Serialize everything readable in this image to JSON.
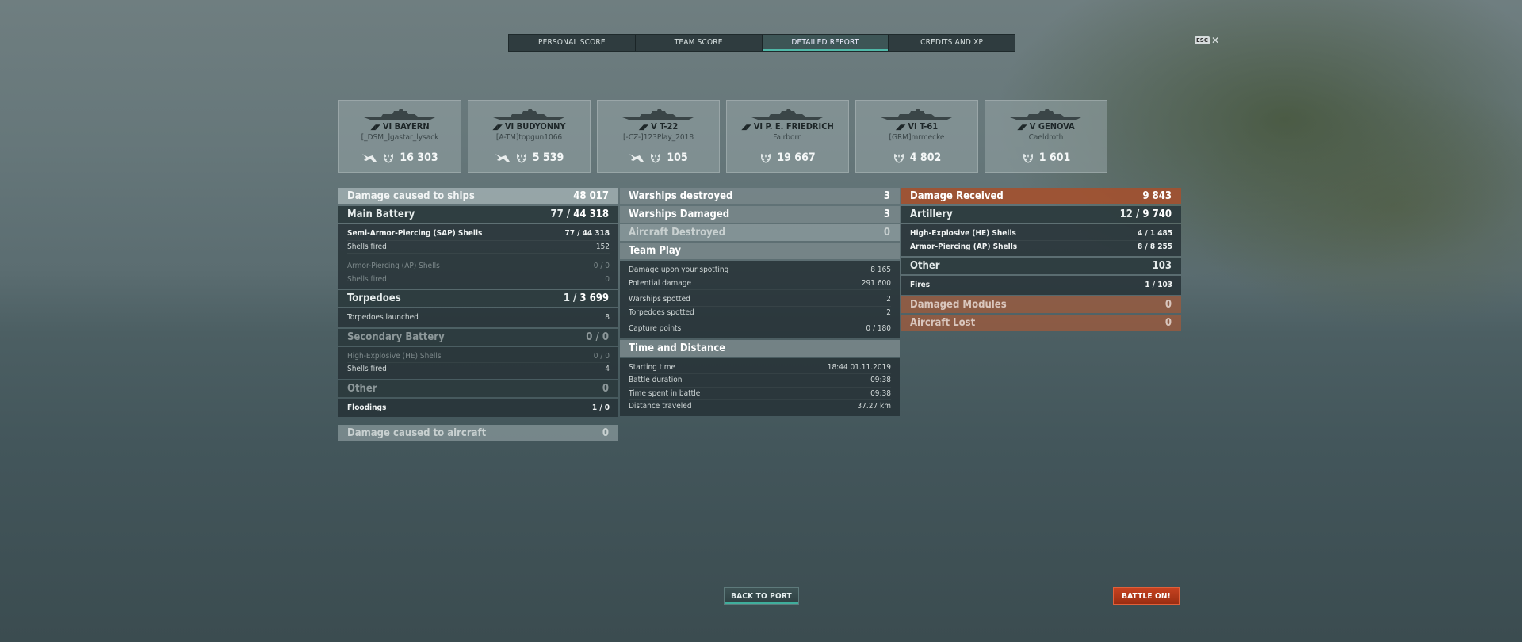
{
  "tabs": [
    {
      "label": "PERSONAL SCORE"
    },
    {
      "label": "TEAM SCORE"
    },
    {
      "label": "DETAILED REPORT"
    },
    {
      "label": "CREDITS AND XP"
    }
  ],
  "esc": {
    "key": "ESC",
    "close": "✕"
  },
  "ships": [
    {
      "name": "VI BAYERN",
      "player": "[_DSM_]gastar_lysack",
      "xp": "16 303",
      "has_plane": true
    },
    {
      "name": "VI BUDYONNY",
      "player": "[A-TM]topgun1066",
      "xp": "5 539",
      "has_plane": true
    },
    {
      "name": "V T-22",
      "player": "[-CZ-]123Play_2018",
      "xp": "105",
      "has_plane": true
    },
    {
      "name": "VI P. E. FRIEDRICH",
      "player": "Fairborn",
      "xp": "19 667",
      "has_plane": false
    },
    {
      "name": "VI T-61",
      "player": "[GRM]mrmecke",
      "xp": "4 802",
      "has_plane": false
    },
    {
      "name": "V GENOVA",
      "player": "Caeldroth",
      "xp": "1 601",
      "has_plane": false
    }
  ],
  "col1": {
    "damage_ships": {
      "label": "Damage caused to ships",
      "value": "48 017"
    },
    "main_battery": {
      "label": "Main Battery",
      "hits": "77",
      "value": "44 318"
    },
    "sap": {
      "label": "Semi-Armor-Piercing (SAP) Shells",
      "hits": "77",
      "value": "44 318"
    },
    "sap_fired": {
      "label": "Shells fired",
      "value": "152"
    },
    "ap": {
      "label": "Armor-Piercing (AP) Shells",
      "hits": "0",
      "value": "0"
    },
    "ap_fired": {
      "label": "Shells fired",
      "value": "0"
    },
    "torpedoes": {
      "label": "Torpedoes",
      "hits": "1",
      "value": "3 699"
    },
    "torp_launched": {
      "label": "Torpedoes launched",
      "value": "8"
    },
    "secondary": {
      "label": "Secondary Battery",
      "hits": "0",
      "value": "0"
    },
    "he": {
      "label": "High-Explosive (HE) Shells",
      "hits": "0",
      "value": "0"
    },
    "he_fired": {
      "label": "Shells fired",
      "value": "4"
    },
    "other": {
      "label": "Other",
      "value": "0"
    },
    "floodings": {
      "label": "Floodings",
      "hits": "1",
      "value": "0"
    },
    "damage_aircraft": {
      "label": "Damage caused to aircraft",
      "value": "0"
    }
  },
  "col2": {
    "destroyed": {
      "label": "Warships destroyed",
      "value": "3"
    },
    "damaged": {
      "label": "Warships Damaged",
      "value": "3"
    },
    "aircraft": {
      "label": "Aircraft Destroyed",
      "value": "0"
    },
    "team_play": {
      "label": "Team Play"
    },
    "spotting_dmg": {
      "label": "Damage upon your spotting",
      "value": "8 165"
    },
    "potential": {
      "label": "Potential damage",
      "value": "291 600"
    },
    "ws_spotted": {
      "label": "Warships spotted",
      "value": "2"
    },
    "tp_spotted": {
      "label": "Torpedoes spotted",
      "value": "2"
    },
    "capture": {
      "label": "Capture points",
      "value": "0 / 180"
    },
    "time": {
      "label": "Time and Distance"
    },
    "start": {
      "label": "Starting time",
      "value": "18:44  01.11.2019"
    },
    "duration": {
      "label": "Battle duration",
      "value": "09:38"
    },
    "spent": {
      "label": "Time spent in battle",
      "value": "09:38"
    },
    "distance": {
      "label": "Distance traveled",
      "value": "37.27 km"
    }
  },
  "col3": {
    "received": {
      "label": "Damage Received",
      "value": "9 843"
    },
    "artillery": {
      "label": "Artillery",
      "hits": "12",
      "value": "9 740"
    },
    "he": {
      "label": "High-Explosive (HE) Shells",
      "hits": "4",
      "value": "1 485"
    },
    "ap": {
      "label": "Armor-Piercing (AP) Shells",
      "hits": "8",
      "value": "8 255"
    },
    "other": {
      "label": "Other",
      "value": "103"
    },
    "fires": {
      "label": "Fires",
      "hits": "1",
      "value": "103"
    },
    "modules": {
      "label": "Damaged Modules",
      "value": "0"
    },
    "aircraft_lost": {
      "label": "Aircraft Lost",
      "value": "0"
    }
  },
  "buttons": {
    "back": "BACK TO PORT",
    "battle": "BATTLE ON!"
  },
  "colors": {
    "accent": "#4fb8a8",
    "orange": "#a05232",
    "battle": "#c54220"
  }
}
